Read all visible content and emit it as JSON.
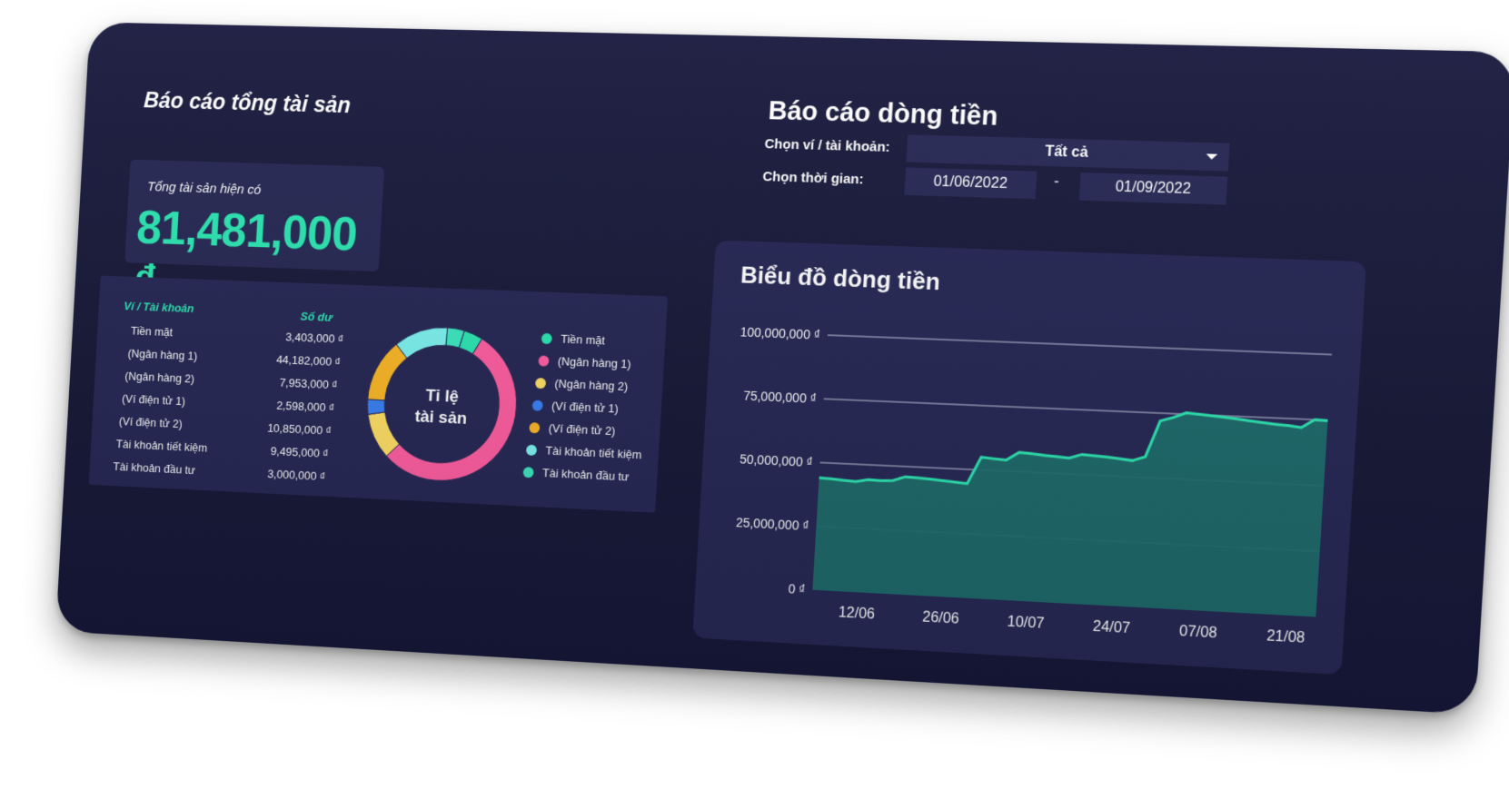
{
  "assets": {
    "title": "Báo cáo tổng tài sản",
    "total_label": "Tổng tài sản hiện có",
    "total_value": "81,481,000 ₫",
    "table": {
      "col_account": "Ví / Tài khoản",
      "col_balance": "Số dư",
      "rows": [
        {
          "name": "Tiền mặt",
          "balance": "3,403,000 ₫"
        },
        {
          "name": "(Ngân hàng 1)",
          "balance": "44,182,000 ₫"
        },
        {
          "name": "(Ngân hàng 2)",
          "balance": "7,953,000 ₫"
        },
        {
          "name": "(Ví điện tử 1)",
          "balance": "2,598,000 ₫"
        },
        {
          "name": "(Ví điện tử 2)",
          "balance": "10,850,000 ₫"
        },
        {
          "name": "Tài khoản tiết kiệm",
          "balance": "9,495,000 ₫"
        },
        {
          "name": "Tài khoản đầu tư",
          "balance": "3,000,000 ₫"
        }
      ]
    },
    "donut": {
      "center_line1": "Tỉ lệ",
      "center_line2": "tài sản",
      "slices": [
        {
          "label": "Tiền mặt",
          "value": 3403000,
          "color": "#2ee6b2"
        },
        {
          "label": "(Ngân hàng 1)",
          "value": 44182000,
          "color": "#ff5fa2"
        },
        {
          "label": "(Ngân hàng 2)",
          "value": 7953000,
          "color": "#ffe066"
        },
        {
          "label": "(Ví điện tử 1)",
          "value": 2598000,
          "color": "#3b82f6"
        },
        {
          "label": "(Ví điện tử 2)",
          "value": 10850000,
          "color": "#fbb828"
        },
        {
          "label": "Tài khoản tiết kiệm",
          "value": 9495000,
          "color": "#7ff3f0"
        },
        {
          "label": "Tài khoản đầu tư",
          "value": 3000000,
          "color": "#3ee8c0"
        }
      ]
    }
  },
  "cashflow": {
    "title": "Báo cáo dòng tiền",
    "wallet_label": "Chọn ví / tài khoản:",
    "wallet_value": "Tất cả",
    "time_label": "Chọn thời gian:",
    "date_from": "01/06/2022",
    "date_sep": "-",
    "date_to": "01/09/2022",
    "chart_title": "Biểu đồ dòng tiền",
    "accent_color": "#2ee6b2",
    "fill_color": "#1f6e6e"
  },
  "chart_data": {
    "type": "area",
    "title": "Biểu đồ dòng tiền",
    "xlabel": "",
    "ylabel": "",
    "ylim": [
      0,
      100000000
    ],
    "y_ticks": [
      "0 ₫",
      "25,000,000 ₫",
      "50,000,000 ₫",
      "75,000,000 ₫",
      "100,000,000 ₫"
    ],
    "y_tick_values": [
      0,
      25000000,
      50000000,
      75000000,
      100000000
    ],
    "x_tick_labels": [
      "12/06",
      "26/06",
      "10/07",
      "24/07",
      "07/08",
      "21/08"
    ],
    "grid": true,
    "series": [
      {
        "values": [
          44000000,
          43800000,
          43500000,
          43200000,
          44200000,
          44000000,
          44300000,
          46000000,
          45800000,
          45500000,
          45200000,
          44800000,
          44500000,
          55000000,
          54600000,
          54300000,
          57500000,
          57200000,
          56800000,
          56500000,
          56200000,
          57800000,
          57500000,
          57200000,
          56800000,
          56300000,
          58000000,
          72000000,
          73500000,
          75500000,
          75200000,
          74800000,
          74500000,
          74000000,
          73500000,
          73000000,
          72600000,
          72300000,
          71800000,
          75000000,
          74800000
        ]
      }
    ]
  }
}
